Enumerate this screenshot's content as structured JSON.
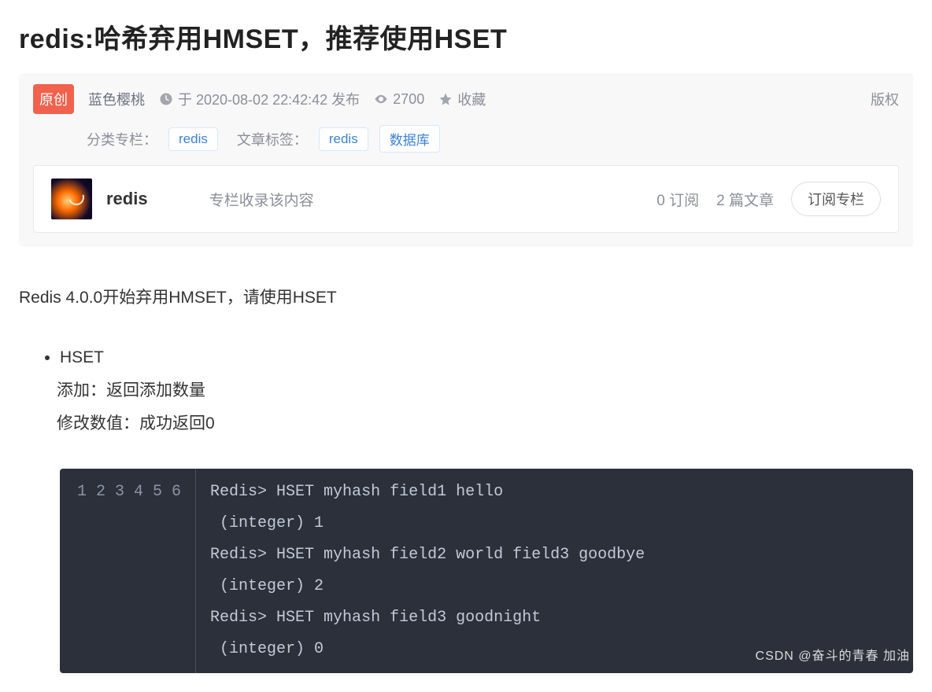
{
  "title": "redis:哈希弃用HMSET，推荐使用HSET",
  "badge_original": "原创",
  "author": "蓝色樱桃",
  "publish_prefix": "于 2020-08-02 22:42:42 发布",
  "views_icon": "eye",
  "views": "2700",
  "favorite_label": "收藏",
  "copyright": "版权",
  "category_label": "分类专栏：",
  "category_tag": "redis",
  "tag_label": "文章标签：",
  "tags": [
    "redis",
    "数据库"
  ],
  "column": {
    "name": "redis",
    "desc": "专栏收录该内容",
    "subs": "0 订阅",
    "articles": "2 篇文章",
    "subscribe_btn": "订阅专栏"
  },
  "body": {
    "intro": "Redis 4.0.0开始弃用HMSET，请使用HSET",
    "li_title": "HSET",
    "li_sub1": "添加：返回添加数量",
    "li_sub2": "修改数值：成功返回0"
  },
  "code_lines": [
    "Redis> HSET myhash field1 hello",
    " (integer) 1",
    "Redis> HSET myhash field2 world field3 goodbye",
    " (integer) 2",
    "Redis> HSET myhash field3 goodnight",
    " (integer) 0"
  ],
  "watermark": "CSDN @奋斗的青春 加油"
}
